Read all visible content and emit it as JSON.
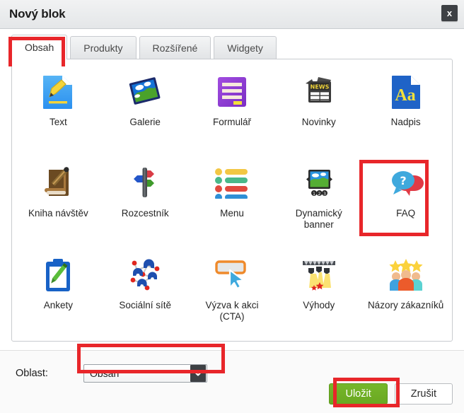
{
  "dialog": {
    "title": "Nový blok",
    "close_label": "x"
  },
  "tabs": [
    {
      "label": "Obsah",
      "active": true,
      "name": "tab-obsah"
    },
    {
      "label": "Produkty",
      "active": false,
      "name": "tab-produkty"
    },
    {
      "label": "Rozšířené",
      "active": false,
      "name": "tab-rozsirene"
    },
    {
      "label": "Widgety",
      "active": false,
      "name": "tab-widgety"
    }
  ],
  "blocks": [
    {
      "label": "Text",
      "icon": "text-document-pencil-icon"
    },
    {
      "label": "Galerie",
      "icon": "gallery-photo-icon"
    },
    {
      "label": "Formulář",
      "icon": "form-lines-icon"
    },
    {
      "label": "Novinky",
      "icon": "news-newspaper-icon"
    },
    {
      "label": "Nadpis",
      "icon": "heading-aa-icon"
    },
    {
      "label": "Kniha návštěv",
      "icon": "guestbook-book-pencil-icon"
    },
    {
      "label": "Rozcestník",
      "icon": "signpost-icon"
    },
    {
      "label": "Menu",
      "icon": "menu-list-icon"
    },
    {
      "label": "Dynamický banner",
      "icon": "dynamic-banner-slider-icon"
    },
    {
      "label": "FAQ",
      "icon": "faq-speech-bubbles-icon"
    },
    {
      "label": "Ankety",
      "icon": "poll-clipboard-icon"
    },
    {
      "label": "Sociální sítě",
      "icon": "social-network-icon"
    },
    {
      "label": "Výzva k akci (CTA)",
      "icon": "cta-cursor-button-icon"
    },
    {
      "label": "Výhody",
      "icon": "benefits-spotlight-icon"
    },
    {
      "label": "Názory zákazníků",
      "icon": "customer-reviews-stars-people-icon"
    }
  ],
  "footer": {
    "region_label": "Oblast:",
    "region_value": "Obsah",
    "save_label": "Uložit",
    "cancel_label": "Zrušit"
  },
  "colors": {
    "highlight": "#e8262a",
    "save_green": "#76b72a",
    "titlebar": "#e9ebed",
    "accent_blue": "#1a73e8"
  }
}
